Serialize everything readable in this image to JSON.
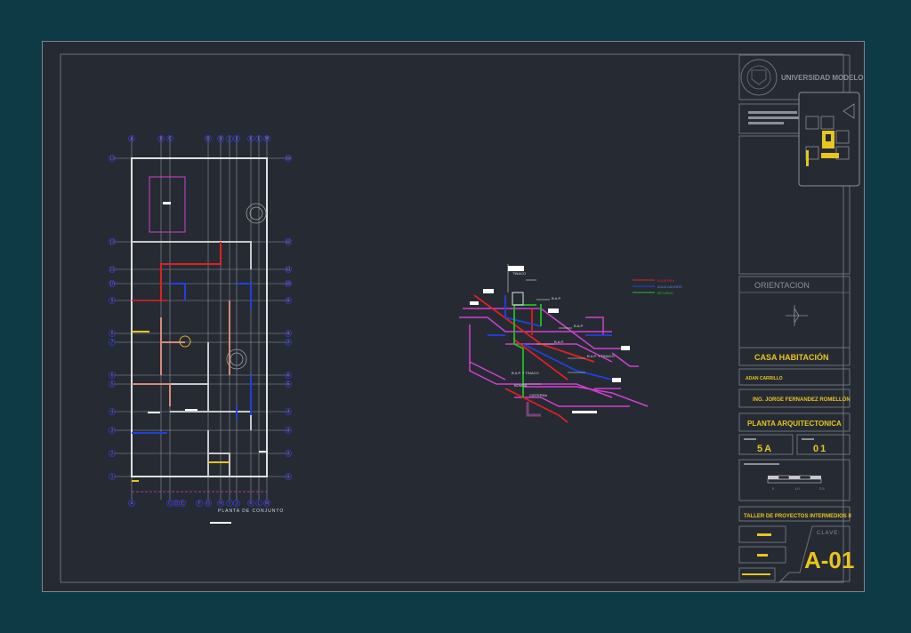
{
  "title_block": {
    "university": "UNIVERSIDAD MODELO",
    "orientation_label": "ORIENTACION",
    "project_title": "CASA HABITACIÓN",
    "student": "ADAN CARRILLO",
    "teacher": "ING. JORGE FERNANDEZ ROMELLÓN",
    "sheet_title": "PLANTA ARQUITECTONICA",
    "semester": "5A",
    "sheet_number": "01",
    "scale_ticks": [
      "0",
      "1.0",
      "2.5"
    ],
    "course": "TALLER DE PROYECTOS INTERMEDIOS II",
    "clave_label": "CLAVE:",
    "clave_value": "A-01"
  },
  "plan": {
    "caption": "PLANTA DE CONJUNTO",
    "grid_letters_top": [
      "A",
      "B",
      "C",
      "G",
      "H",
      "I",
      "J",
      "K",
      "L",
      "M"
    ],
    "grid_letters_bottom": [
      "A",
      "C",
      "D",
      "E",
      "F",
      "G",
      "H",
      "I",
      "J",
      "K",
      "L",
      "M"
    ],
    "grid_numbers": [
      "13",
      "12",
      "11",
      "10",
      "9",
      "8",
      "7",
      "6",
      "5",
      "4",
      "3",
      "2",
      "1"
    ]
  },
  "isometric": {
    "labels": [
      "TINACO",
      "B.A.P.",
      "B.A.P.",
      "B.A.P.",
      "B.A.P. Y TINACO",
      "B.A.P. Y TINACO",
      "BOMBA",
      "CISTERNA"
    ],
    "legend": [
      "AGUA FRIA",
      "AGUA CALIENTE",
      "RETORNO"
    ]
  },
  "colors": {
    "sheet_bg": "#262b33",
    "outer_bg": "#0e3a45",
    "title_yellow": "#e8c51f",
    "magenta": "#d040d0",
    "red": "#e02020",
    "blue": "#2040e0",
    "green": "#20c020"
  }
}
